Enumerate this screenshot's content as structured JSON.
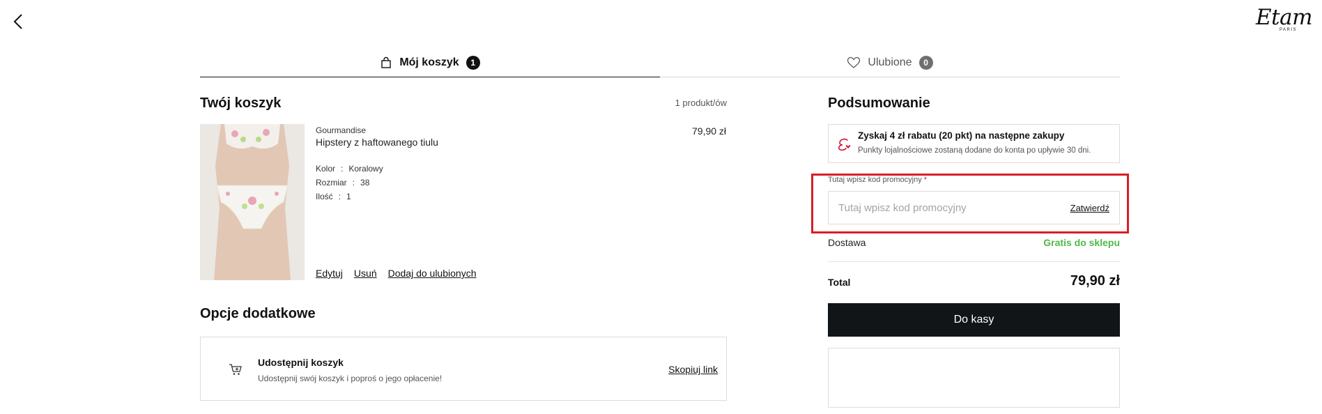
{
  "brand": {
    "name": "Etam",
    "sub": "PARIS"
  },
  "tabs": [
    {
      "label": "Mój koszyk",
      "count": "1"
    },
    {
      "label": "Ulubione",
      "count": "0"
    }
  ],
  "cart": {
    "title": "Twój koszyk",
    "count_text": "1 produkt/ów",
    "item": {
      "brand": "Gourmandise",
      "name": "Hipstery z haftowanego tiulu",
      "price": "79,90 zł",
      "attributes": [
        {
          "key": "Kolor",
          "value": "Koralowy"
        },
        {
          "key": "Rozmiar",
          "value": "38"
        },
        {
          "key": "Ilość",
          "value": "1"
        }
      ],
      "separator": ":",
      "actions": {
        "edit": "Edytuj",
        "remove": "Usuń",
        "favorite": "Dodaj do ulubionych"
      }
    }
  },
  "options": {
    "title": "Opcje dodatkowe",
    "share": {
      "title": "Udostępnij koszyk",
      "desc": "Udostępnij swój koszyk i poproś o jego opłacenie!",
      "link": "Skopiuj link"
    }
  },
  "summary": {
    "title": "Podsumowanie",
    "loyalty": {
      "title": "Zyskaj 4 zł rabatu (20 pkt) na następne zakupy",
      "desc": "Punkty lojalnościowe zostaną dodane do konta po upływie 30 dni."
    },
    "promo": {
      "label": "Tutaj wpisz kod promocyjny",
      "required_mark": "*",
      "placeholder": "Tutaj wpisz kod promocyjny",
      "value": "",
      "submit": "Zatwierdź"
    },
    "shipping": {
      "label": "Dostawa",
      "value": "Gratis do sklepu"
    },
    "total": {
      "label": "Total",
      "value": "79,90 zł"
    },
    "checkout_label": "Do kasy"
  },
  "colors": {
    "accent_green": "#4fb848",
    "highlight_red": "#d71f26",
    "button_dark": "#111518",
    "loyalty_red": "#d6143a"
  },
  "icons": [
    "back-arrow-icon",
    "shopping-bag-icon",
    "heart-icon",
    "cart-icon",
    "loyalty-e-icon"
  ]
}
